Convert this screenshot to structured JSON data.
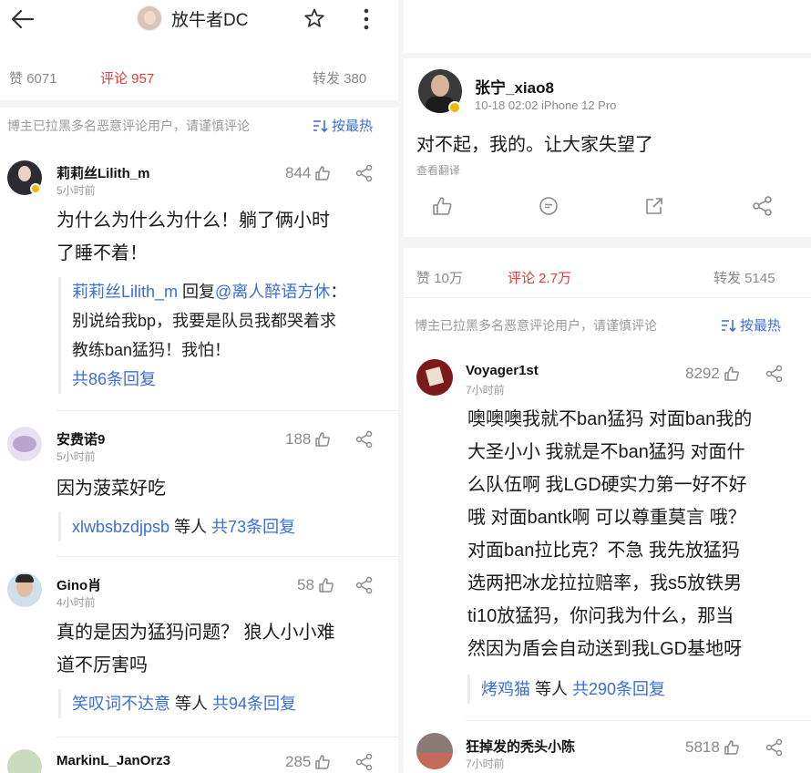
{
  "left": {
    "header": {
      "title": "放牛者DC"
    },
    "stats": {
      "likes": "赞 6071",
      "comments": "评论 957",
      "reposts": "转发 380"
    },
    "notice": "博主已拉黑多名恶意评论用户，请谨慎评论",
    "sort": "按最热",
    "comments": [
      {
        "name": "莉莉丝Lilith_m",
        "time": "5小时前",
        "likes": "844",
        "text1": "为什么为什么为什么！躺了俩小时",
        "text2": "了睡不着！",
        "reply": {
          "author": "莉莉丝Lilith_m",
          "reply_word": " 回复",
          "mention": "@离人醉语方休",
          "colon": "：",
          "line2": "别说给我bp，我要是队员我都哭着求",
          "line3": "教练ban猛犸！我怕！",
          "total": "共86条回复"
        }
      },
      {
        "name": "安费诺9",
        "time": "5小时前",
        "likes": "188",
        "text1": "因为菠菜好吃",
        "reply": {
          "users": "xlwbsbzdjpsb",
          "etc": " 等人 ",
          "total": "共73条回复"
        }
      },
      {
        "name": "Gino肖",
        "time": "4小时前",
        "likes": "58",
        "text1": "真的是因为猛犸问题？ 狼人小小难",
        "text2": "道不厉害吗",
        "reply": {
          "users": "笑叹词不达意",
          "etc": " 等人 ",
          "total": "共94条回复"
        }
      },
      {
        "name": "MarkinL_JanOrz3",
        "likes": "285"
      }
    ]
  },
  "right": {
    "post": {
      "author": "张宁_xiao8",
      "meta": "10-18 02:02   iPhone 12 Pro",
      "text": "对不起，我的。让大家失望了",
      "translate": "查看翻译"
    },
    "stats": {
      "likes": "赞 10万",
      "comments": "评论 2.7万",
      "reposts": "转发 5145"
    },
    "notice": "博主已拉黑多名恶意评论用户，请谨慎评论",
    "sort": "按最热",
    "comments": [
      {
        "name": "Voyager1st",
        "time": "7小时前",
        "likes": "8292",
        "lines": [
          "噢噢噢我就不ban猛犸 对面ban我的",
          "大圣小小 我就是不ban猛犸 对面什",
          "么队伍啊 我LGD硬实力第一好不好",
          "哦 对面bantk啊 可以尊重莫言 哦？",
          "对面ban拉比克？不急 我先放猛犸",
          "选两把冰龙拉拉赔率，我s5放铁男",
          "ti10放猛犸，你问我为什么，那当",
          "然因为盾会自动送到我LGD基地呀"
        ],
        "reply": {
          "users": "烤鸡猫",
          "etc": " 等人 ",
          "total": "共290条回复"
        }
      },
      {
        "name": "狂掉发的秃头小陈",
        "time": "7小时前",
        "likes": "5818"
      }
    ]
  },
  "colors": {
    "accent_red": "#e83a3a",
    "link_blue": "#3a6fd8",
    "muted": "#9a9a9a"
  }
}
